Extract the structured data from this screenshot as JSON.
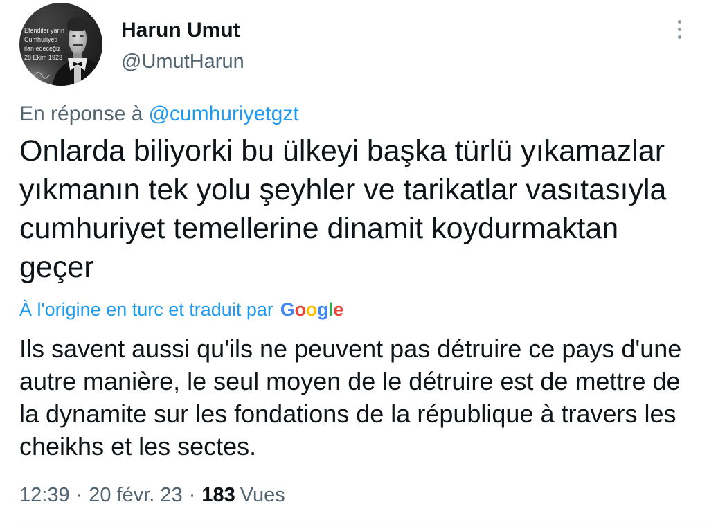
{
  "author": {
    "name": "Harun Umut",
    "handle": "@UmutHarun",
    "avatar_caption": [
      "Efendiler yarın",
      "Cumhuriyeti",
      "ilan edeceğiz",
      "28 Ekim 1923"
    ]
  },
  "icons": {
    "more": "more-vertical-icon"
  },
  "reply": {
    "prefix": "En réponse à",
    "mention": "@cumhuriyetgzt"
  },
  "tweet": {
    "text_lines": [
      "Onlarda biliyorki bu ülkeyi başka türlü yıkamazlar",
      "yıkmanın tek yolu şeyhler ve tarikatlar vasıtasıyla",
      "cumhuriyet temellerine dinamit koydurmaktan",
      "geçer"
    ]
  },
  "translation": {
    "attribution": "À l'origine en turc et traduit par",
    "provider": "Google",
    "provider_colors": [
      "#4285F4",
      "#EA4335",
      "#FBBC05",
      "#4285F4",
      "#34A853",
      "#EA4335"
    ],
    "text_lines": [
      "Ils savent aussi qu'ils ne peuvent pas détruire ce pays d'une",
      "autre manière, le seul moyen de le détruire est de mettre de",
      "la dynamite sur les fondations de la république à travers les",
      "cheikhs et les sectes."
    ]
  },
  "meta": {
    "time": "12:39",
    "separator": "·",
    "date": "20 févr. 23",
    "views_count": "183",
    "views_label": "Vues"
  },
  "colors": {
    "background": "#ffffff",
    "text": "#0f1419",
    "secondary": "#536471",
    "accent": "#1d9bf0",
    "divider": "#eff3f4"
  }
}
